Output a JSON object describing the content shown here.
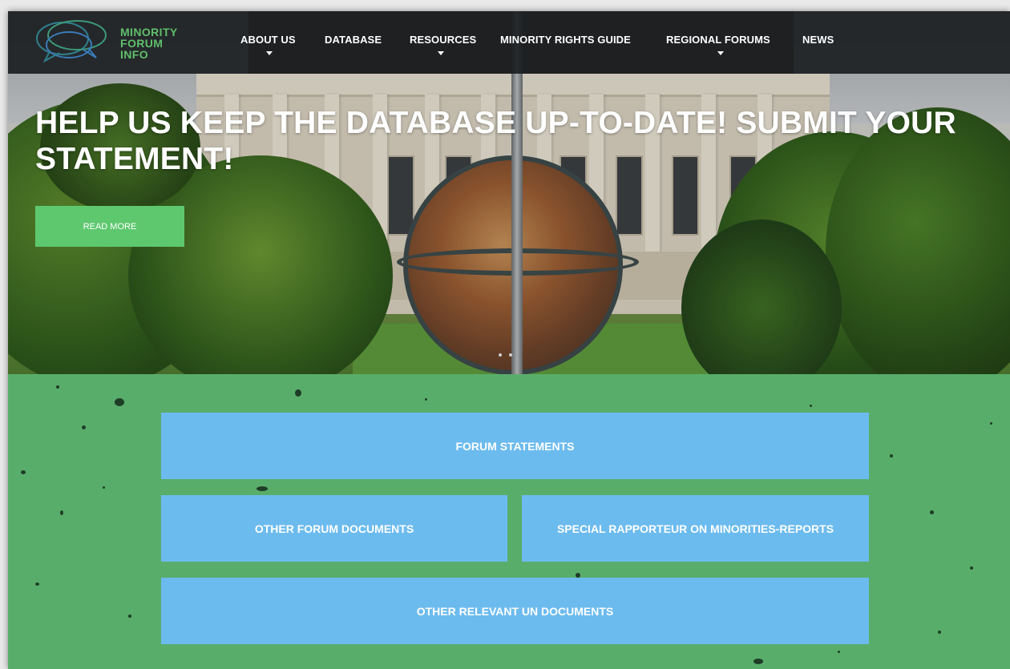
{
  "brand": {
    "logo_lines": [
      "MINORITY",
      "FORUM",
      "INFO"
    ],
    "logo_color": "#5fbf6b"
  },
  "nav": {
    "items": [
      {
        "label": "ABOUT US",
        "has_dropdown": true
      },
      {
        "label": "DATABASE",
        "has_dropdown": false
      },
      {
        "label": "RESOURCES",
        "has_dropdown": true
      },
      {
        "label": "MINORITY RIGHTS GUIDE",
        "has_dropdown": false
      },
      {
        "label": "REGIONAL FORUMS",
        "has_dropdown": true
      },
      {
        "label": "NEWS",
        "has_dropdown": false
      }
    ]
  },
  "hero": {
    "headline": "HELP US KEEP THE DATABASE UP-TO-DATE! SUBMIT YOUR STATEMENT!",
    "button_label": "READ MORE",
    "button_color": "#5ec86f",
    "slide_count": 2
  },
  "tiles": {
    "forum_statements": "FORUM STATEMENTS",
    "other_forum_documents": "OTHER FORUM DOCUMENTS",
    "special_rapporteur": "SPECIAL RAPPORTEUR ON MINORITIES-REPORTS",
    "other_un_documents": "OTHER RELEVANT UN DOCUMENTS",
    "tile_color": "#6cbbef",
    "section_color": "#59ad6b"
  }
}
